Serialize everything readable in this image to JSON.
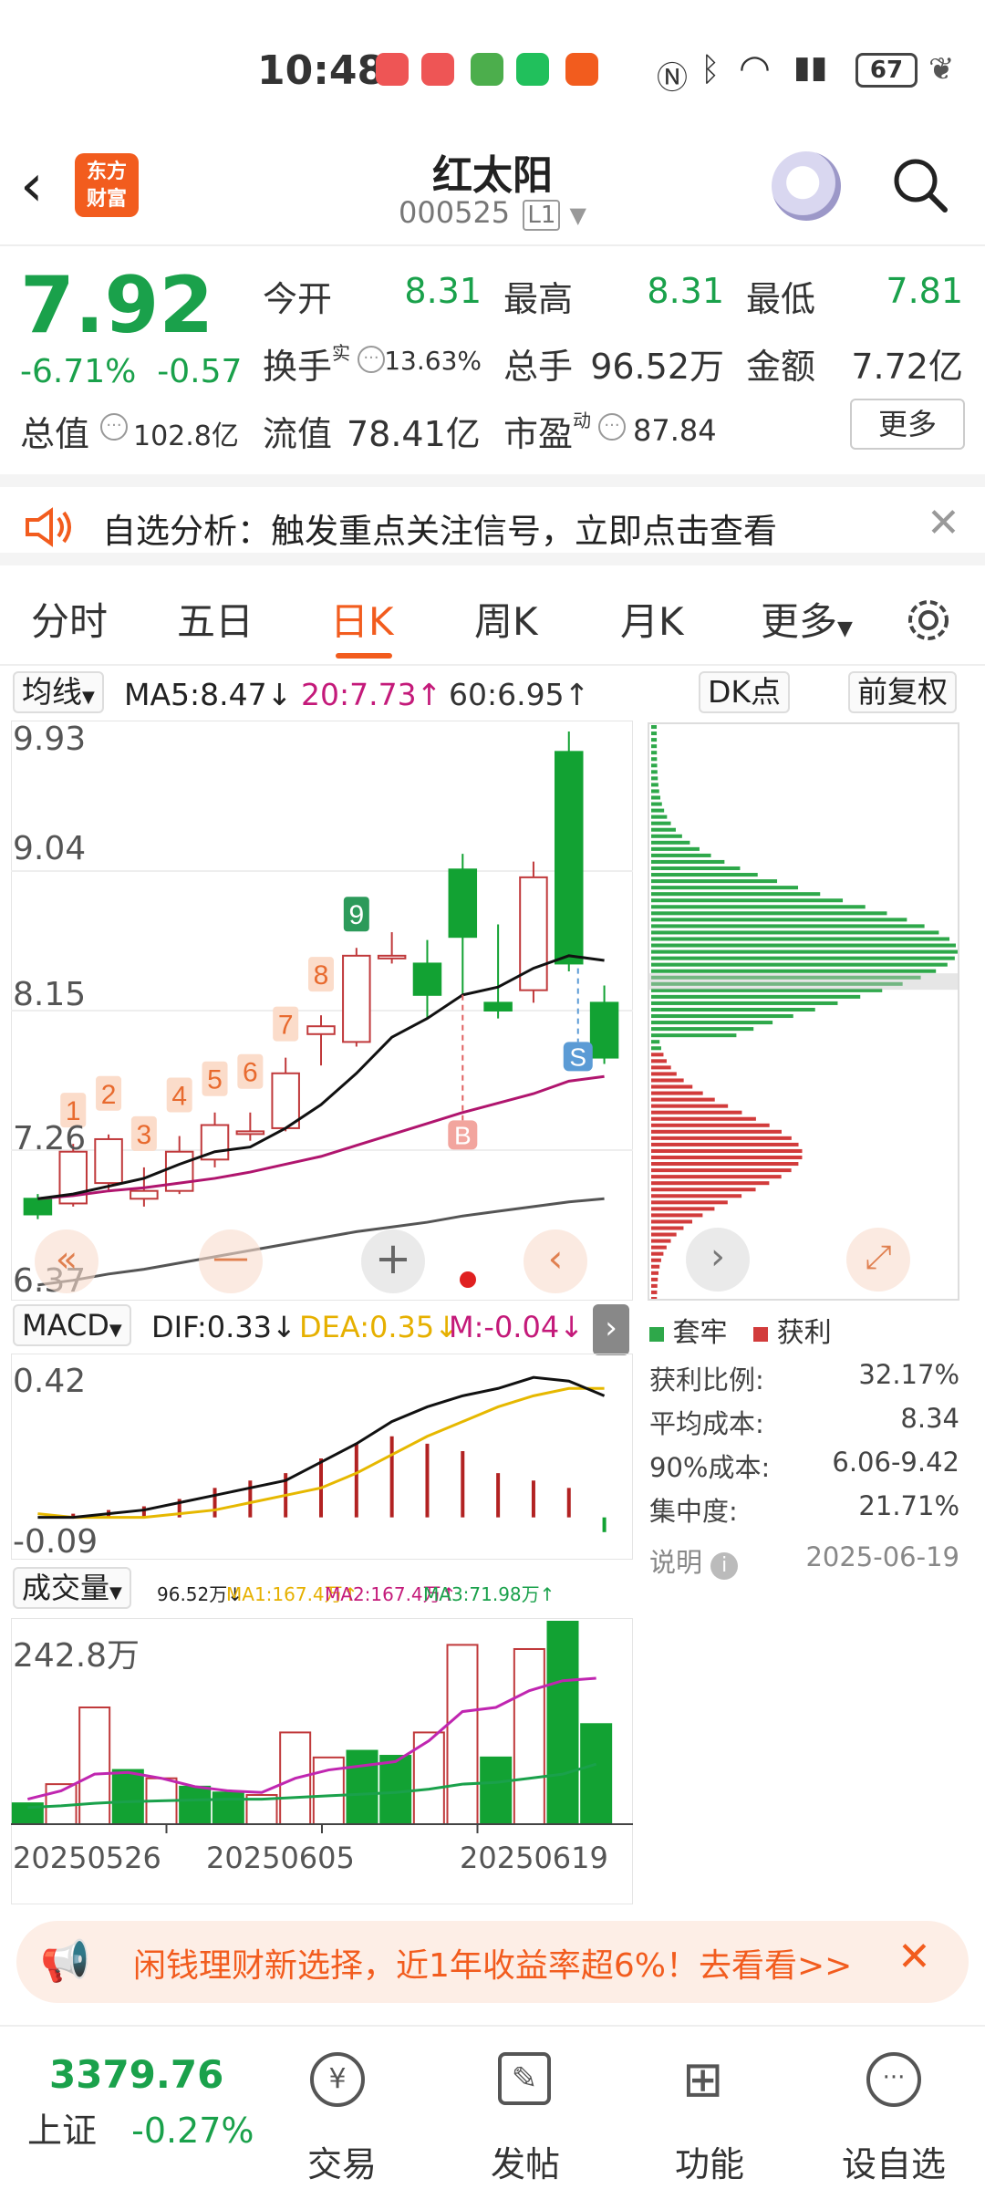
{
  "status": {
    "time": "10:48",
    "battery": "67"
  },
  "header": {
    "back": "‹",
    "logo_line1": "东方",
    "logo_line2": "财富",
    "title": "红太阳",
    "code": "000525",
    "level": "L1"
  },
  "quote": {
    "price": "7.92",
    "change_pct": "-6.71%",
    "change": "-0.57",
    "open_label": "今开",
    "open": "8.31",
    "high_label": "最高",
    "high": "8.31",
    "low_label": "最低",
    "low": "7.81",
    "turnover_label": "换手",
    "turnover_sup": "实",
    "turnover": "13.63%",
    "volume_label": "总手",
    "volume": "96.52万",
    "amount_label": "金额",
    "amount": "7.72亿",
    "mcap_label": "总值",
    "mcap": "102.8亿",
    "float_label": "流值",
    "float": "78.41亿",
    "pe_label": "市盈",
    "pe_sup": "动",
    "pe": "87.84",
    "more": "更多"
  },
  "banner": {
    "text": "自选分析：触发重点关注信号，立即点击查看"
  },
  "tabs": [
    "分时",
    "五日",
    "日K",
    "周K",
    "月K",
    "更多"
  ],
  "ma": {
    "selector": "均线",
    "ma5": "MA5:8.47↓",
    "ma20": "20:7.73↑",
    "ma60": "60:6.95↑",
    "dk": "DK点",
    "adjust": "前复权"
  },
  "kline": {
    "y_labels": [
      "9.93",
      "9.04",
      "8.15",
      "7.26",
      "6.37"
    ],
    "ymin": 6.37,
    "ymax": 9.93,
    "candles": [
      {
        "o": 6.95,
        "c": 6.85,
        "h": 6.98,
        "l": 6.82
      },
      {
        "o": 6.92,
        "c": 7.25,
        "h": 7.3,
        "l": 6.9
      },
      {
        "o": 7.05,
        "c": 7.33,
        "h": 7.36,
        "l": 7.0
      },
      {
        "o": 6.95,
        "c": 7.0,
        "h": 7.15,
        "l": 6.9
      },
      {
        "o": 7.0,
        "c": 7.25,
        "h": 7.35,
        "l": 6.98
      },
      {
        "o": 7.2,
        "c": 7.42,
        "h": 7.5,
        "l": 7.15
      },
      {
        "o": 7.38,
        "c": 7.38,
        "h": 7.5,
        "l": 7.32
      },
      {
        "o": 7.4,
        "c": 7.75,
        "h": 7.85,
        "l": 7.38
      },
      {
        "o": 8.0,
        "c": 8.05,
        "h": 8.12,
        "l": 7.8
      },
      {
        "o": 7.95,
        "c": 8.5,
        "h": 8.55,
        "l": 7.92
      },
      {
        "o": 8.5,
        "c": 8.5,
        "h": 8.65,
        "l": 8.45
      },
      {
        "o": 8.45,
        "c": 8.25,
        "h": 8.6,
        "l": 8.1
      },
      {
        "o": 9.05,
        "c": 8.62,
        "h": 9.15,
        "l": 8.25
      },
      {
        "o": 8.2,
        "c": 8.15,
        "h": 8.7,
        "l": 8.1
      },
      {
        "o": 8.28,
        "c": 9.0,
        "h": 9.1,
        "l": 8.2
      },
      {
        "o": 9.8,
        "c": 8.45,
        "h": 9.93,
        "l": 8.4
      },
      {
        "o": 8.2,
        "c": 7.85,
        "h": 8.31,
        "l": 7.81
      }
    ],
    "markers": [
      "1",
      "2",
      "3",
      "4",
      "5",
      "6",
      "7",
      "8",
      "9"
    ],
    "ma5_line": [
      6.95,
      6.98,
      7.03,
      7.08,
      7.17,
      7.25,
      7.28,
      7.4,
      7.55,
      7.75,
      7.98,
      8.1,
      8.25,
      8.3,
      8.42,
      8.5,
      8.47
    ],
    "ma20_line": [
      6.95,
      6.97,
      7.0,
      7.02,
      7.05,
      7.08,
      7.12,
      7.17,
      7.22,
      7.29,
      7.36,
      7.43,
      7.5,
      7.56,
      7.62,
      7.7,
      7.73
    ],
    "ma60_line": [
      6.4,
      6.43,
      6.47,
      6.5,
      6.54,
      6.58,
      6.62,
      6.66,
      6.7,
      6.74,
      6.77,
      6.8,
      6.84,
      6.87,
      6.9,
      6.93,
      6.95
    ],
    "buy_sign": "B",
    "sell_sign": "S"
  },
  "chips": {
    "legend_trapped": "套牢",
    "legend_profit": "获利",
    "rows": [
      {
        "label": "获利比例:",
        "value": "32.17%"
      },
      {
        "label": "平均成本:",
        "value": "8.34"
      },
      {
        "label": "90%成本:",
        "value": "6.06-9.42"
      },
      {
        "label": "集中度:",
        "value": "21.71%"
      }
    ],
    "note": "说明",
    "date": "2025-06-19",
    "colors": {
      "trapped": "#2ea84a",
      "profit": "#d23b3b"
    }
  },
  "macd": {
    "selector": "MACD",
    "dif": "DIF:0.33↓",
    "dea": "DEA:0.35↓",
    "m": "M:-0.04↓",
    "top": "0.42",
    "bottom": "-0.09",
    "dif_line": [
      0.0,
      0.0,
      0.01,
      0.02,
      0.04,
      0.06,
      0.08,
      0.1,
      0.15,
      0.2,
      0.26,
      0.3,
      0.33,
      0.35,
      0.38,
      0.37,
      0.33
    ],
    "dea_line": [
      0.01,
      0.0,
      0.0,
      0.0,
      0.01,
      0.02,
      0.04,
      0.06,
      0.08,
      0.12,
      0.17,
      0.22,
      0.26,
      0.3,
      0.33,
      0.35,
      0.35
    ],
    "hist": [
      0.0,
      0.01,
      0.02,
      0.03,
      0.05,
      0.08,
      0.1,
      0.12,
      0.16,
      0.2,
      0.22,
      0.2,
      0.18,
      0.12,
      0.1,
      0.08,
      -0.04
    ]
  },
  "volume": {
    "selector": "成交量",
    "vol": "96.52万↓",
    "ma1": "MA1:167.4万↑",
    "ma2": "MA2:167.4万↑",
    "ma3": "MA3:71.98万↑",
    "top": "242.8万",
    "bars": [
      25,
      48,
      140,
      65,
      55,
      45,
      38,
      35,
      110,
      80,
      88,
      82,
      110,
      215,
      80,
      210,
      242.8,
      120
    ],
    "dates": [
      "20250526",
      "20250605",
      "20250619"
    ]
  },
  "ad": {
    "text": "闲钱理财新选择，近1年收益率超6%！去看看>>"
  },
  "footer": {
    "index": "3379.76",
    "index_name": "上证",
    "index_chg": "-0.27%",
    "items": [
      "交易",
      "发帖",
      "功能",
      "设自选"
    ]
  }
}
